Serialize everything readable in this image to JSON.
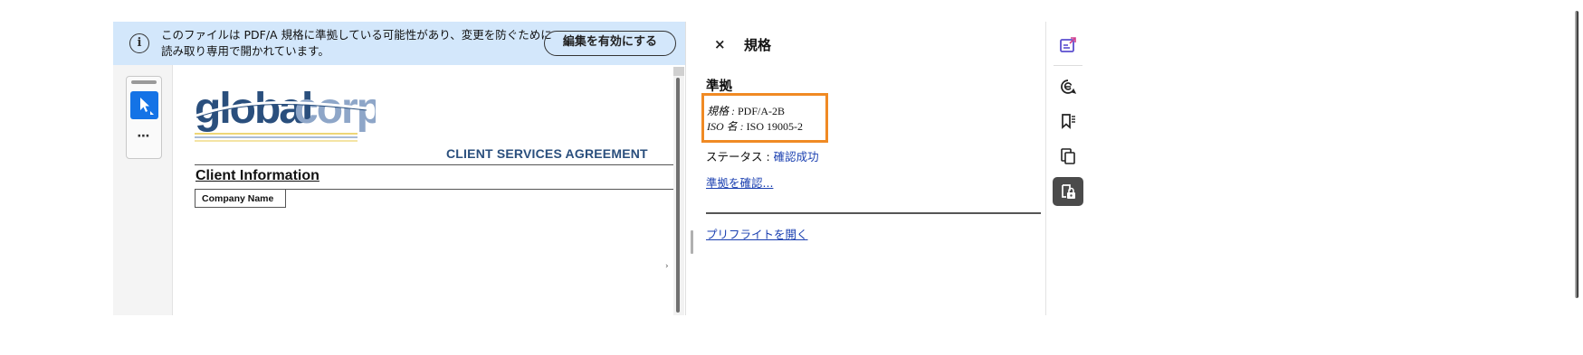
{
  "banner": {
    "message_line1": "このファイルは PDF/A 規格に準拠している可能性があり、変更を防ぐために",
    "message_line2": "読み取り専用で開かれています。",
    "enable_edit_label": "編集を有効にする",
    "icon": "info-icon"
  },
  "tools": {
    "select_icon": "cursor-arrow-icon",
    "more_label": "⋯"
  },
  "document": {
    "logo_left": "global",
    "logo_right": "corp",
    "title": "CLIENT SERVICES AGREEMENT",
    "section_heading": "Client Information",
    "company_name_label": "Company Name"
  },
  "panel": {
    "close_label": "×",
    "title": "規格",
    "section_heading": "準拠",
    "standard_label": "規格 : ",
    "standard_value": "PDF/A-2B",
    "iso_label": "ISO 名 : ",
    "iso_value": "ISO 19005-2",
    "status_label": "ステータス : ",
    "status_value": "確認成功",
    "verify_link": "準拠を確認...",
    "preflight_link": "プリフライトを開く"
  },
  "rail": {
    "items": [
      {
        "icon": "edit-pdf-icon"
      },
      {
        "icon": "comment-icon"
      },
      {
        "icon": "bookmark-icon"
      },
      {
        "icon": "pages-icon"
      },
      {
        "icon": "standards-lock-icon",
        "active": true
      }
    ]
  },
  "colors": {
    "banner_bg": "#d3e7fb",
    "highlight_box": "#f08a24",
    "link": "#1a3fb0",
    "tool_active": "#1473e6",
    "rail_active": "#4b4b4b",
    "rail_accent": "#5b4fcf",
    "logo_dark": "#2a4f7d",
    "logo_light": "#8ea6c8"
  }
}
